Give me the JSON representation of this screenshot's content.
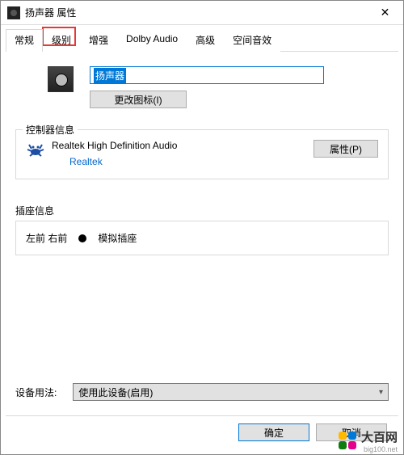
{
  "window": {
    "title": "扬声器 属性"
  },
  "tabs": {
    "items": [
      {
        "label": "常规"
      },
      {
        "label": "级别"
      },
      {
        "label": "增强"
      },
      {
        "label": "Dolby Audio"
      },
      {
        "label": "高级"
      },
      {
        "label": "空间音效"
      }
    ],
    "active_index": 0,
    "highlight_index": 1
  },
  "general": {
    "device_name": "扬声器",
    "change_icon_label": "更改图标(I)"
  },
  "controller": {
    "group_label": "控制器信息",
    "name": "Realtek High Definition Audio",
    "vendor": "Realtek",
    "properties_btn": "属性(P)"
  },
  "jack": {
    "group_label": "插座信息",
    "position": "左前 右前",
    "type": "模拟插座"
  },
  "usage": {
    "label": "设备用法:",
    "selected": "使用此设备(启用)"
  },
  "footer": {
    "ok": "确定",
    "cancel": "取消"
  },
  "watermark": {
    "brand": "大百网",
    "url": "big100.net"
  }
}
